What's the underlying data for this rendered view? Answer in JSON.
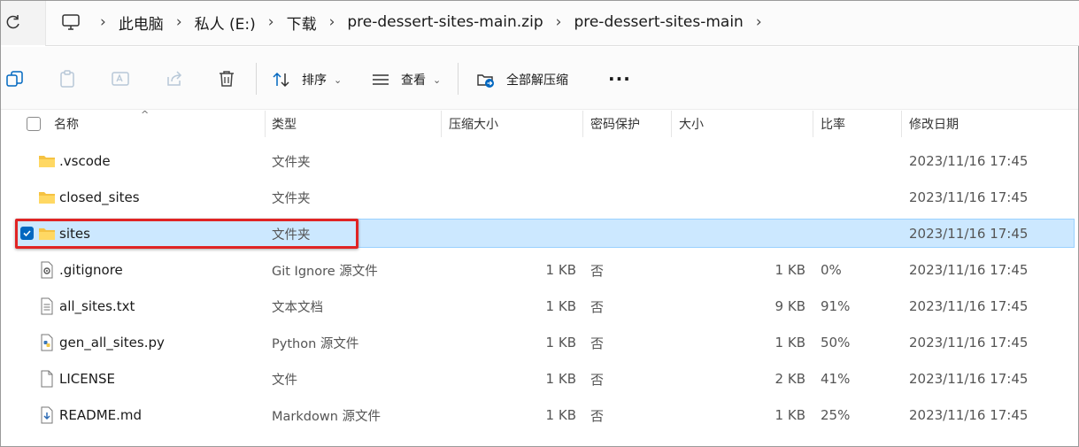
{
  "breadcrumb": [
    "此电脑",
    "私人 (E:)",
    "下载",
    "pre-dessert-sites-main.zip",
    "pre-dessert-sites-main"
  ],
  "toolbar": {
    "sort_label": "排序",
    "view_label": "查看",
    "extract_all_label": "全部解压缩",
    "more_label": "···"
  },
  "columns": {
    "name": "名称",
    "type": "类型",
    "compressed_size": "压缩大小",
    "password": "密码保护",
    "size": "大小",
    "ratio": "比率",
    "modified": "修改日期"
  },
  "files": [
    {
      "name": ".vscode",
      "icon": "folder-icon",
      "type": "文件夹",
      "compressed_size": "",
      "password": "",
      "size": "",
      "ratio": "",
      "modified": "2023/11/16 17:45"
    },
    {
      "name": "closed_sites",
      "icon": "folder-icon",
      "type": "文件夹",
      "compressed_size": "",
      "password": "",
      "size": "",
      "ratio": "",
      "modified": "2023/11/16 17:45"
    },
    {
      "name": "sites",
      "icon": "folder-icon",
      "type": "文件夹",
      "compressed_size": "",
      "password": "",
      "size": "",
      "ratio": "",
      "modified": "2023/11/16 17:45"
    },
    {
      "name": ".gitignore",
      "icon": "settings-file-icon",
      "type": "Git Ignore 源文件",
      "compressed_size": "1 KB",
      "password": "否",
      "size": "1 KB",
      "ratio": "0%",
      "modified": "2023/11/16 17:45"
    },
    {
      "name": "all_sites.txt",
      "icon": "text-file-icon",
      "type": "文本文档",
      "compressed_size": "1 KB",
      "password": "否",
      "size": "9 KB",
      "ratio": "91%",
      "modified": "2023/11/16 17:45"
    },
    {
      "name": "gen_all_sites.py",
      "icon": "python-file-icon",
      "type": "Python 源文件",
      "compressed_size": "1 KB",
      "password": "否",
      "size": "1 KB",
      "ratio": "50%",
      "modified": "2023/11/16 17:45"
    },
    {
      "name": "LICENSE",
      "icon": "blank-file-icon",
      "type": "文件",
      "compressed_size": "1 KB",
      "password": "否",
      "size": "2 KB",
      "ratio": "41%",
      "modified": "2023/11/16 17:45"
    },
    {
      "name": "README.md",
      "icon": "markdown-file-icon",
      "type": "Markdown 源文件",
      "compressed_size": "1 KB",
      "password": "否",
      "size": "1 KB",
      "ratio": "25%",
      "modified": "2023/11/16 17:45"
    }
  ],
  "selected_index": 2,
  "colors": {
    "selection_bg": "#cce8ff",
    "selection_border": "#99d1ff",
    "highlight_box": "#e02424",
    "folder": "#f5c242",
    "accent": "#0067c0"
  }
}
